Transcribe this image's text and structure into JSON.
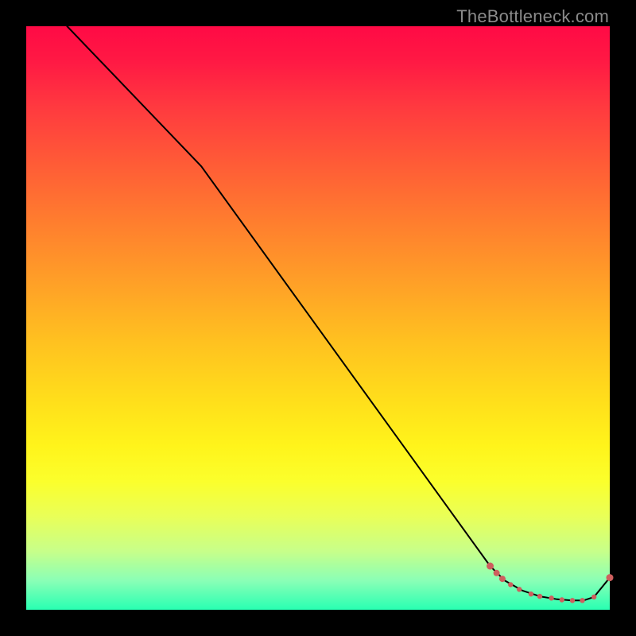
{
  "watermark": "TheBottleneck.com",
  "colors": {
    "line": "#000000",
    "point": "#ce5f5e",
    "gradient_top": "#ff0a45",
    "gradient_bottom": "#28ffb2"
  },
  "chart_data": {
    "type": "line",
    "title": "",
    "xlabel": "",
    "ylabel": "",
    "xlim": [
      0,
      100
    ],
    "ylim": [
      0,
      100
    ],
    "line": {
      "x": [
        7.0,
        30.0,
        79.5,
        82.0,
        85.0,
        88.0,
        91.0,
        93.5,
        95.5,
        97.3,
        100.0
      ],
      "y": [
        100.0,
        76.0,
        7.5,
        5.0,
        3.3,
        2.3,
        1.8,
        1.6,
        1.6,
        2.2,
        5.5
      ]
    },
    "points": [
      {
        "x": 79.5,
        "y": 7.5,
        "r": 4.5
      },
      {
        "x": 80.6,
        "y": 6.3,
        "r": 4.0
      },
      {
        "x": 81.6,
        "y": 5.3,
        "r": 4.0
      },
      {
        "x": 83.0,
        "y": 4.3,
        "r": 3.2
      },
      {
        "x": 84.5,
        "y": 3.5,
        "r": 3.2
      },
      {
        "x": 86.5,
        "y": 2.7,
        "r": 3.2
      },
      {
        "x": 88.0,
        "y": 2.3,
        "r": 3.2
      },
      {
        "x": 90.0,
        "y": 2.0,
        "r": 3.2
      },
      {
        "x": 91.8,
        "y": 1.7,
        "r": 3.2
      },
      {
        "x": 93.6,
        "y": 1.6,
        "r": 3.2
      },
      {
        "x": 95.3,
        "y": 1.6,
        "r": 3.2
      },
      {
        "x": 97.3,
        "y": 2.2,
        "r": 3.2
      },
      {
        "x": 100.0,
        "y": 5.5,
        "r": 4.5
      }
    ]
  }
}
